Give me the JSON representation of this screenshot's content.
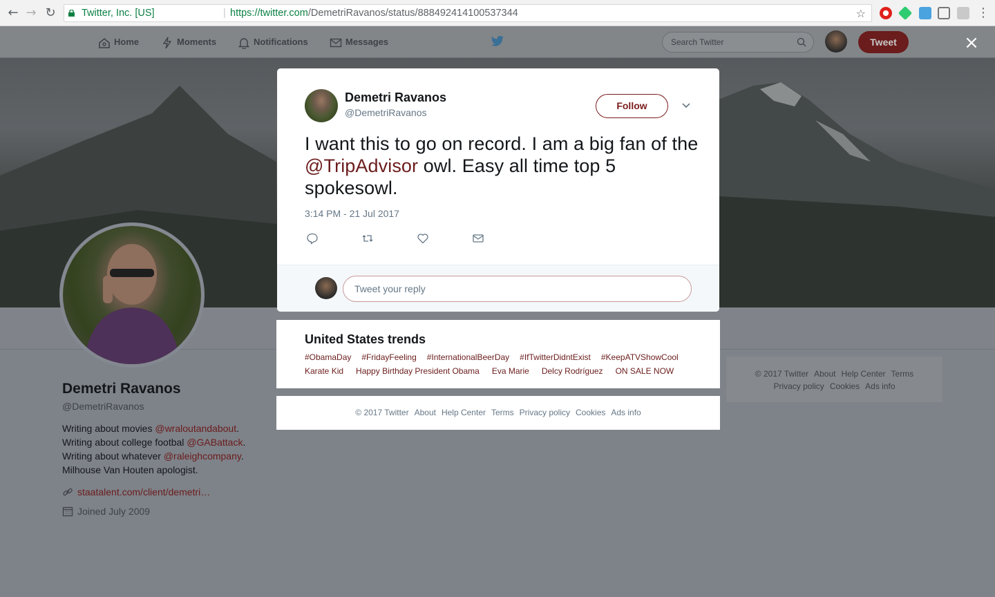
{
  "browser": {
    "secure_label": "Twitter, Inc. [US]",
    "url_prefix": "https://twitter.com",
    "url_path": "/DemetriRavanos/status/888492414100537344"
  },
  "topbar": {
    "home": "Home",
    "moments": "Moments",
    "notifications": "Notifications",
    "messages": "Messages",
    "search_placeholder": "Search Twitter",
    "tweet_button": "Tweet",
    "close": "×"
  },
  "profile": {
    "name": "Demetri Ravanos",
    "handle": "@DemetriRavanos",
    "bio": [
      {
        "text": "Writing about movies ",
        "mention": "@wraloutandabout",
        "after": "."
      },
      {
        "text": "Writing about college footbal ",
        "mention": "@GABattack",
        "after": "."
      },
      {
        "text": "Writing about whatever ",
        "mention": "@raleighcompany",
        "after": "."
      },
      {
        "text": "Milhouse Van Houten apologist.",
        "mention": "",
        "after": ""
      }
    ],
    "link": "staatalent.com/client/demetri…",
    "joined": "Joined July 2009"
  },
  "side_footer": {
    "row1": [
      "© 2017 Twitter",
      "About",
      "Help Center",
      "Terms"
    ],
    "row2": [
      "Privacy policy",
      "Cookies",
      "Ads info"
    ]
  },
  "tweet": {
    "author_name": "Demetri Ravanos",
    "author_handle": "@DemetriRavanos",
    "follow_label": "Follow",
    "text_before": "I want this to go on record. I am a big fan of the ",
    "mention": "@TripAdvisor",
    "text_after": " owl. Easy all time top 5 spokesowl.",
    "timestamp": "3:14 PM - 21 Jul 2017",
    "reply_placeholder": "Tweet your reply"
  },
  "trends": {
    "title": "United States trends",
    "row1": [
      "#ObamaDay",
      "#FridayFeeling",
      "#InternationalBeerDay",
      "#IfTwitterDidntExist",
      "#KeepATVShowCool"
    ],
    "row2": [
      "Karate Kid",
      "Happy Birthday President Obama",
      "Eva Marie",
      "Delcy Rodríguez",
      "ON SALE NOW"
    ]
  },
  "footer": [
    "© 2017 Twitter",
    "About",
    "Help Center",
    "Terms",
    "Privacy policy",
    "Cookies",
    "Ads info"
  ],
  "colors": {
    "accent": "#6b1c1c",
    "overlay": "#7e8289",
    "secure_green": "#0b8043"
  }
}
